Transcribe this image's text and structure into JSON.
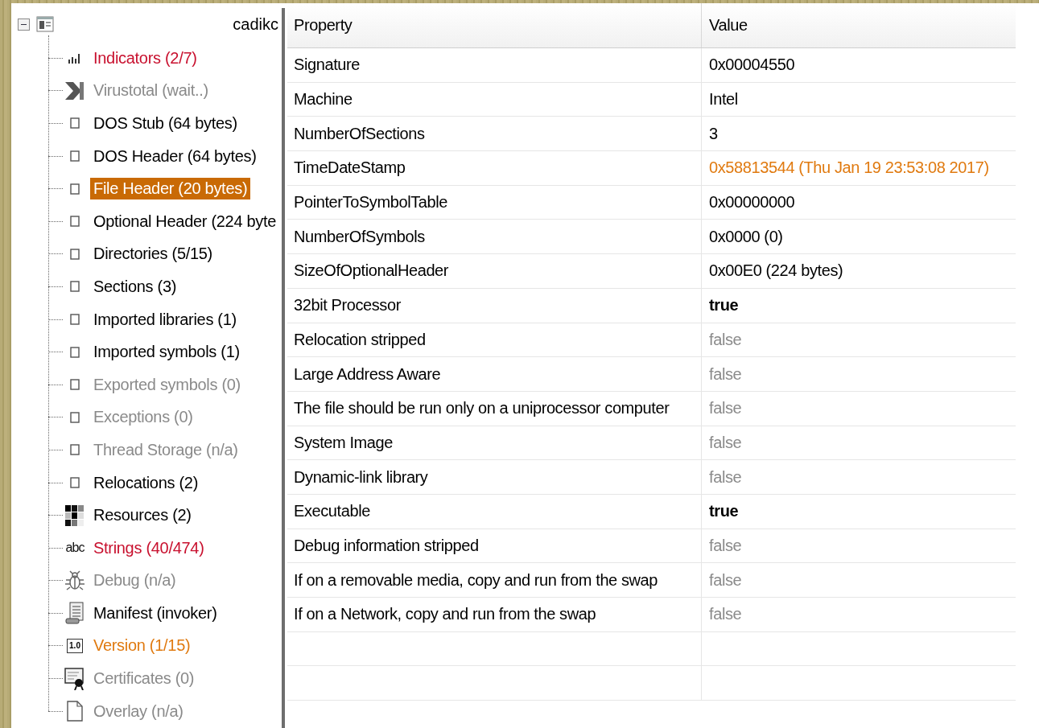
{
  "tree": {
    "root": {
      "label": "cadikc",
      "expanded": true
    },
    "items": [
      {
        "label": "Indicators (2/7)",
        "kind": "chart",
        "alert": true,
        "warning": false,
        "disabled": false,
        "selected": false
      },
      {
        "label": "Virustotal (wait..)",
        "kind": "virustotal",
        "alert": false,
        "warning": false,
        "disabled": true,
        "selected": false
      },
      {
        "label": "DOS Stub (64 bytes)",
        "kind": "square",
        "alert": false,
        "warning": false,
        "disabled": false,
        "selected": false
      },
      {
        "label": "DOS Header (64 bytes)",
        "kind": "square",
        "alert": false,
        "warning": false,
        "disabled": false,
        "selected": false
      },
      {
        "label": "File Header (20 bytes)",
        "kind": "square",
        "alert": false,
        "warning": false,
        "disabled": false,
        "selected": true
      },
      {
        "label": "Optional Header (224 byte",
        "kind": "square",
        "alert": false,
        "warning": false,
        "disabled": false,
        "selected": false
      },
      {
        "label": "Directories (5/15)",
        "kind": "square",
        "alert": false,
        "warning": false,
        "disabled": false,
        "selected": false
      },
      {
        "label": "Sections (3)",
        "kind": "square",
        "alert": false,
        "warning": false,
        "disabled": false,
        "selected": false
      },
      {
        "label": "Imported libraries (1)",
        "kind": "square",
        "alert": false,
        "warning": false,
        "disabled": false,
        "selected": false
      },
      {
        "label": "Imported symbols (1)",
        "kind": "square",
        "alert": false,
        "warning": false,
        "disabled": false,
        "selected": false
      },
      {
        "label": "Exported symbols (0)",
        "kind": "square",
        "alert": false,
        "warning": false,
        "disabled": true,
        "selected": false
      },
      {
        "label": "Exceptions (0)",
        "kind": "square",
        "alert": false,
        "warning": false,
        "disabled": true,
        "selected": false
      },
      {
        "label": "Thread Storage (n/a)",
        "kind": "square",
        "alert": false,
        "warning": false,
        "disabled": true,
        "selected": false
      },
      {
        "label": "Relocations (2)",
        "kind": "square",
        "alert": false,
        "warning": false,
        "disabled": false,
        "selected": false
      },
      {
        "label": "Resources (2)",
        "kind": "resources",
        "alert": false,
        "warning": false,
        "disabled": false,
        "selected": false
      },
      {
        "label": "Strings (40/474)",
        "kind": "text",
        "icon_text": "abc",
        "alert": true,
        "warning": false,
        "disabled": false,
        "selected": false
      },
      {
        "label": "Debug (n/a)",
        "kind": "bug",
        "alert": false,
        "warning": false,
        "disabled": true,
        "selected": false
      },
      {
        "label": "Manifest (invoker)",
        "kind": "scroll",
        "alert": false,
        "warning": false,
        "disabled": false,
        "selected": false
      },
      {
        "label": "Version (1/15)",
        "kind": "badge",
        "icon_text": "1.0",
        "alert": false,
        "warning": true,
        "disabled": false,
        "selected": false
      },
      {
        "label": "Certificates (0)",
        "kind": "certificate",
        "alert": false,
        "warning": false,
        "disabled": true,
        "selected": false
      },
      {
        "label": "Overlay (n/a)",
        "kind": "page",
        "alert": false,
        "warning": false,
        "disabled": true,
        "selected": false
      }
    ]
  },
  "table": {
    "columns": [
      "Property",
      "Value"
    ],
    "rows": [
      {
        "property": "Signature",
        "value": "0x00004550",
        "bold": false,
        "disabled": false,
        "warning": false
      },
      {
        "property": "Machine",
        "value": "Intel",
        "bold": false,
        "disabled": false,
        "warning": false
      },
      {
        "property": "NumberOfSections",
        "value": "3",
        "bold": false,
        "disabled": false,
        "warning": false
      },
      {
        "property": "TimeDateStamp",
        "value": "0x58813544 (Thu Jan 19 23:53:08 2017)",
        "bold": false,
        "disabled": false,
        "warning": true
      },
      {
        "property": "PointerToSymbolTable",
        "value": "0x00000000",
        "bold": false,
        "disabled": false,
        "warning": false
      },
      {
        "property": "NumberOfSymbols",
        "value": "0x0000 (0)",
        "bold": false,
        "disabled": false,
        "warning": false
      },
      {
        "property": "SizeOfOptionalHeader",
        "value": "0x00E0 (224 bytes)",
        "bold": false,
        "disabled": false,
        "warning": false
      },
      {
        "property": "32bit Processor",
        "value": "true",
        "bold": true,
        "disabled": false,
        "warning": false
      },
      {
        "property": "Relocation stripped",
        "value": "false",
        "bold": false,
        "disabled": true,
        "warning": false
      },
      {
        "property": "Large Address Aware",
        "value": "false",
        "bold": false,
        "disabled": true,
        "warning": false
      },
      {
        "property": "The file should be run only on a uniprocessor computer",
        "value": "false",
        "bold": false,
        "disabled": true,
        "warning": false
      },
      {
        "property": "System Image",
        "value": "false",
        "bold": false,
        "disabled": true,
        "warning": false
      },
      {
        "property": "Dynamic-link library",
        "value": "false",
        "bold": false,
        "disabled": true,
        "warning": false
      },
      {
        "property": "Executable",
        "value": "true",
        "bold": true,
        "disabled": false,
        "warning": false
      },
      {
        "property": "Debug information stripped",
        "value": "false",
        "bold": false,
        "disabled": true,
        "warning": false
      },
      {
        "property": "If on a removable media, copy and run from the swap",
        "value": "false",
        "bold": false,
        "disabled": true,
        "warning": false
      },
      {
        "property": "If on a Network, copy and run from the swap",
        "value": "false",
        "bold": false,
        "disabled": true,
        "warning": false
      }
    ]
  }
}
